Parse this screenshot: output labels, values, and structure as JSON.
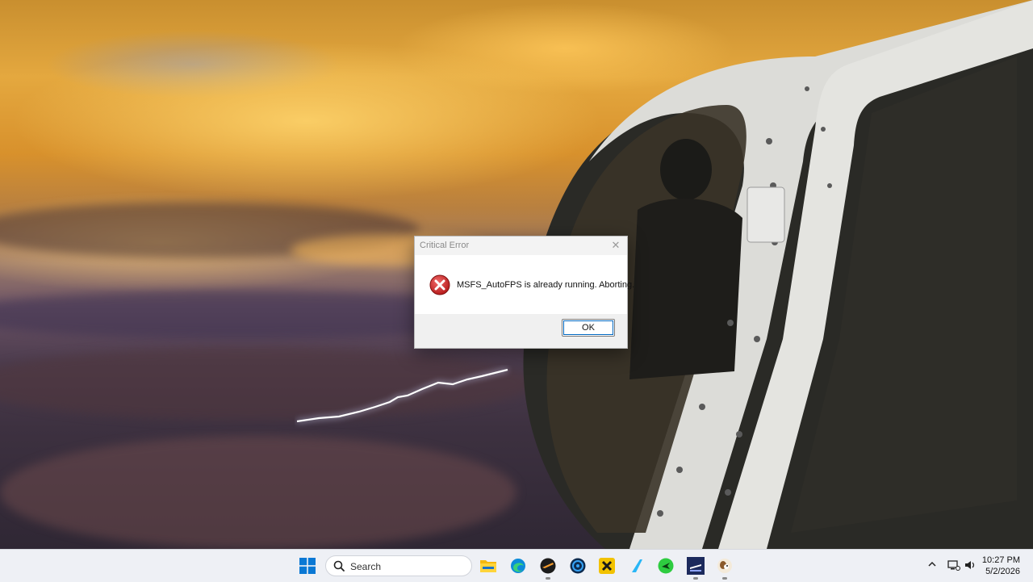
{
  "dialog": {
    "title": "Critical Error",
    "close_glyph": "✕",
    "icon": "error-icon",
    "message": "MSFS_AutoFPS is already running. Aborting.",
    "ok_label": "OK"
  },
  "taskbar": {
    "search_label": "Search",
    "apps": [
      {
        "name": "start-menu-icon"
      },
      {
        "name": "file-explorer-icon"
      },
      {
        "name": "edge-browser-icon"
      },
      {
        "name": "flight-simulator-icon"
      },
      {
        "name": "app-circle-icon"
      },
      {
        "name": "x-app-icon"
      },
      {
        "name": "blue-sail-app-icon"
      },
      {
        "name": "green-plane-app-icon"
      },
      {
        "name": "msfs-app-icon"
      },
      {
        "name": "dog-app-icon"
      }
    ],
    "tray": {
      "chevron": "show-hidden-icons",
      "network_icon": "network-icon",
      "volume_icon": "volume-icon",
      "time": "10:27 PM",
      "date": "5/2/2026"
    }
  },
  "colors": {
    "accent": "#0067c0",
    "error_red": "#c62828",
    "taskbar_bg": "#eef0f5"
  }
}
